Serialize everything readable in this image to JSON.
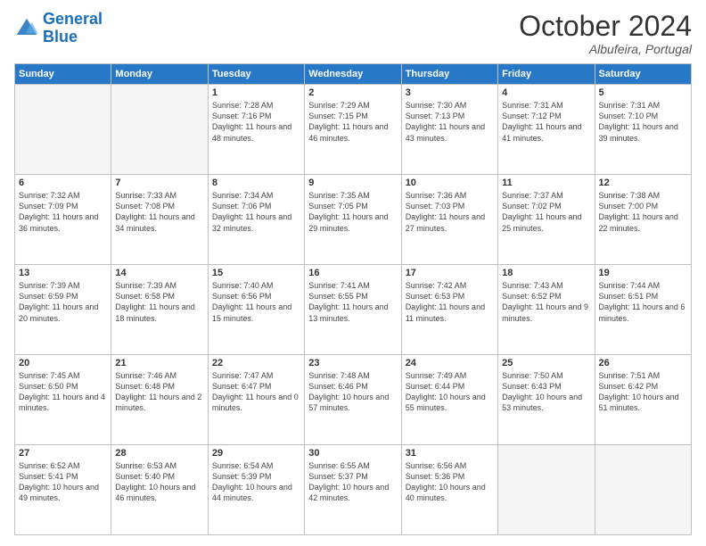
{
  "logo": {
    "line1": "General",
    "line2": "Blue"
  },
  "title": "October 2024",
  "location": "Albufeira, Portugal",
  "weekdays": [
    "Sunday",
    "Monday",
    "Tuesday",
    "Wednesday",
    "Thursday",
    "Friday",
    "Saturday"
  ],
  "weeks": [
    [
      {
        "day": "",
        "sunrise": "",
        "sunset": "",
        "daylight": ""
      },
      {
        "day": "",
        "sunrise": "",
        "sunset": "",
        "daylight": ""
      },
      {
        "day": "1",
        "sunrise": "Sunrise: 7:28 AM",
        "sunset": "Sunset: 7:16 PM",
        "daylight": "Daylight: 11 hours and 48 minutes."
      },
      {
        "day": "2",
        "sunrise": "Sunrise: 7:29 AM",
        "sunset": "Sunset: 7:15 PM",
        "daylight": "Daylight: 11 hours and 46 minutes."
      },
      {
        "day": "3",
        "sunrise": "Sunrise: 7:30 AM",
        "sunset": "Sunset: 7:13 PM",
        "daylight": "Daylight: 11 hours and 43 minutes."
      },
      {
        "day": "4",
        "sunrise": "Sunrise: 7:31 AM",
        "sunset": "Sunset: 7:12 PM",
        "daylight": "Daylight: 11 hours and 41 minutes."
      },
      {
        "day": "5",
        "sunrise": "Sunrise: 7:31 AM",
        "sunset": "Sunset: 7:10 PM",
        "daylight": "Daylight: 11 hours and 39 minutes."
      }
    ],
    [
      {
        "day": "6",
        "sunrise": "Sunrise: 7:32 AM",
        "sunset": "Sunset: 7:09 PM",
        "daylight": "Daylight: 11 hours and 36 minutes."
      },
      {
        "day": "7",
        "sunrise": "Sunrise: 7:33 AM",
        "sunset": "Sunset: 7:08 PM",
        "daylight": "Daylight: 11 hours and 34 minutes."
      },
      {
        "day": "8",
        "sunrise": "Sunrise: 7:34 AM",
        "sunset": "Sunset: 7:06 PM",
        "daylight": "Daylight: 11 hours and 32 minutes."
      },
      {
        "day": "9",
        "sunrise": "Sunrise: 7:35 AM",
        "sunset": "Sunset: 7:05 PM",
        "daylight": "Daylight: 11 hours and 29 minutes."
      },
      {
        "day": "10",
        "sunrise": "Sunrise: 7:36 AM",
        "sunset": "Sunset: 7:03 PM",
        "daylight": "Daylight: 11 hours and 27 minutes."
      },
      {
        "day": "11",
        "sunrise": "Sunrise: 7:37 AM",
        "sunset": "Sunset: 7:02 PM",
        "daylight": "Daylight: 11 hours and 25 minutes."
      },
      {
        "day": "12",
        "sunrise": "Sunrise: 7:38 AM",
        "sunset": "Sunset: 7:00 PM",
        "daylight": "Daylight: 11 hours and 22 minutes."
      }
    ],
    [
      {
        "day": "13",
        "sunrise": "Sunrise: 7:39 AM",
        "sunset": "Sunset: 6:59 PM",
        "daylight": "Daylight: 11 hours and 20 minutes."
      },
      {
        "day": "14",
        "sunrise": "Sunrise: 7:39 AM",
        "sunset": "Sunset: 6:58 PM",
        "daylight": "Daylight: 11 hours and 18 minutes."
      },
      {
        "day": "15",
        "sunrise": "Sunrise: 7:40 AM",
        "sunset": "Sunset: 6:56 PM",
        "daylight": "Daylight: 11 hours and 15 minutes."
      },
      {
        "day": "16",
        "sunrise": "Sunrise: 7:41 AM",
        "sunset": "Sunset: 6:55 PM",
        "daylight": "Daylight: 11 hours and 13 minutes."
      },
      {
        "day": "17",
        "sunrise": "Sunrise: 7:42 AM",
        "sunset": "Sunset: 6:53 PM",
        "daylight": "Daylight: 11 hours and 11 minutes."
      },
      {
        "day": "18",
        "sunrise": "Sunrise: 7:43 AM",
        "sunset": "Sunset: 6:52 PM",
        "daylight": "Daylight: 11 hours and 9 minutes."
      },
      {
        "day": "19",
        "sunrise": "Sunrise: 7:44 AM",
        "sunset": "Sunset: 6:51 PM",
        "daylight": "Daylight: 11 hours and 6 minutes."
      }
    ],
    [
      {
        "day": "20",
        "sunrise": "Sunrise: 7:45 AM",
        "sunset": "Sunset: 6:50 PM",
        "daylight": "Daylight: 11 hours and 4 minutes."
      },
      {
        "day": "21",
        "sunrise": "Sunrise: 7:46 AM",
        "sunset": "Sunset: 6:48 PM",
        "daylight": "Daylight: 11 hours and 2 minutes."
      },
      {
        "day": "22",
        "sunrise": "Sunrise: 7:47 AM",
        "sunset": "Sunset: 6:47 PM",
        "daylight": "Daylight: 11 hours and 0 minutes."
      },
      {
        "day": "23",
        "sunrise": "Sunrise: 7:48 AM",
        "sunset": "Sunset: 6:46 PM",
        "daylight": "Daylight: 10 hours and 57 minutes."
      },
      {
        "day": "24",
        "sunrise": "Sunrise: 7:49 AM",
        "sunset": "Sunset: 6:44 PM",
        "daylight": "Daylight: 10 hours and 55 minutes."
      },
      {
        "day": "25",
        "sunrise": "Sunrise: 7:50 AM",
        "sunset": "Sunset: 6:43 PM",
        "daylight": "Daylight: 10 hours and 53 minutes."
      },
      {
        "day": "26",
        "sunrise": "Sunrise: 7:51 AM",
        "sunset": "Sunset: 6:42 PM",
        "daylight": "Daylight: 10 hours and 51 minutes."
      }
    ],
    [
      {
        "day": "27",
        "sunrise": "Sunrise: 6:52 AM",
        "sunset": "Sunset: 5:41 PM",
        "daylight": "Daylight: 10 hours and 49 minutes."
      },
      {
        "day": "28",
        "sunrise": "Sunrise: 6:53 AM",
        "sunset": "Sunset: 5:40 PM",
        "daylight": "Daylight: 10 hours and 46 minutes."
      },
      {
        "day": "29",
        "sunrise": "Sunrise: 6:54 AM",
        "sunset": "Sunset: 5:39 PM",
        "daylight": "Daylight: 10 hours and 44 minutes."
      },
      {
        "day": "30",
        "sunrise": "Sunrise: 6:55 AM",
        "sunset": "Sunset: 5:37 PM",
        "daylight": "Daylight: 10 hours and 42 minutes."
      },
      {
        "day": "31",
        "sunrise": "Sunrise: 6:56 AM",
        "sunset": "Sunset: 5:36 PM",
        "daylight": "Daylight: 10 hours and 40 minutes."
      },
      {
        "day": "",
        "sunrise": "",
        "sunset": "",
        "daylight": ""
      },
      {
        "day": "",
        "sunrise": "",
        "sunset": "",
        "daylight": ""
      }
    ]
  ]
}
